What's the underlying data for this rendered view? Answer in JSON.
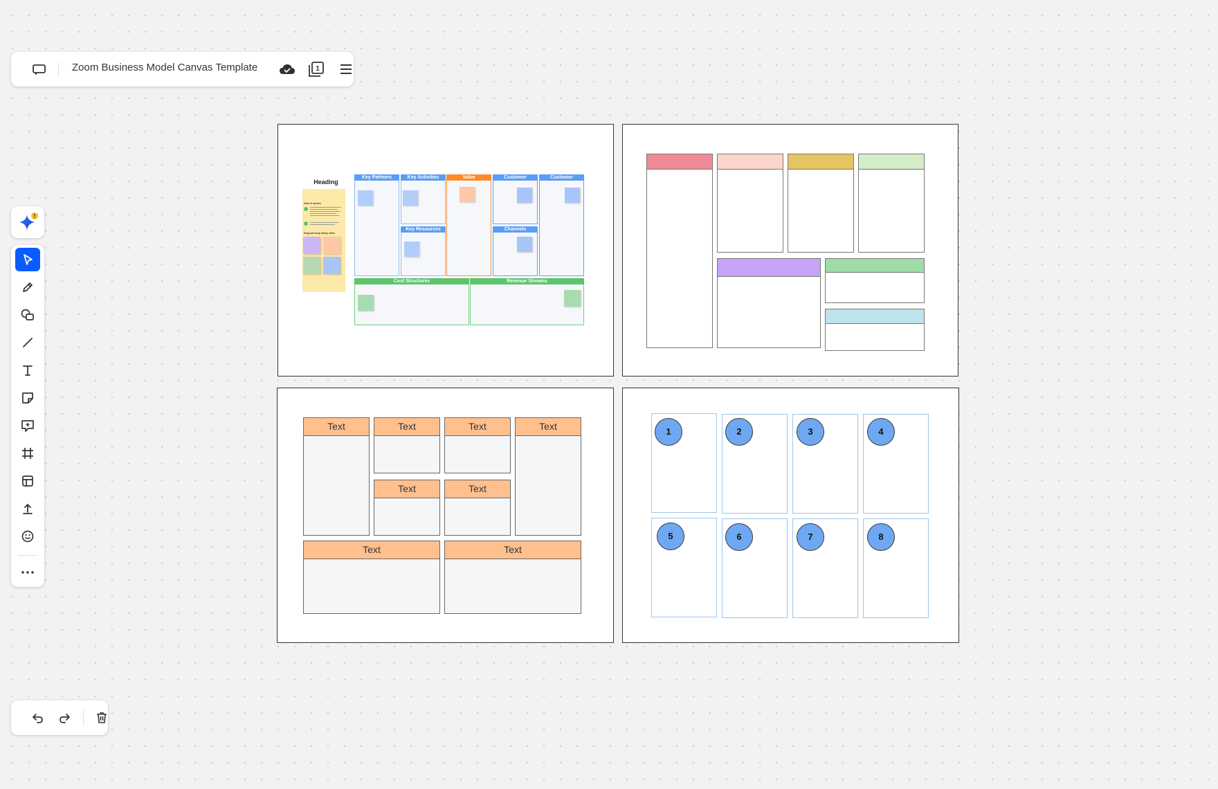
{
  "topbar": {
    "title": "Zoom Business Model Canvas Template",
    "icons": [
      "toggle-sidebar-icon",
      "cloud-saved-icon",
      "pages-icon",
      "menu-icon"
    ],
    "pages_count": "1"
  },
  "ai_assistant": {
    "icon": "ai-sparkle-icon",
    "badge": "!"
  },
  "tools": [
    {
      "name": "select",
      "icon": "pointer-icon",
      "active": true
    },
    {
      "name": "pen",
      "icon": "pen-icon"
    },
    {
      "name": "shapes",
      "icon": "shapes-icon"
    },
    {
      "name": "line",
      "icon": "line-icon"
    },
    {
      "name": "text",
      "icon": "text-icon"
    },
    {
      "name": "sticky-note",
      "icon": "sticky-note-icon"
    },
    {
      "name": "comment",
      "icon": "comment-icon"
    },
    {
      "name": "frame",
      "icon": "frame-icon"
    },
    {
      "name": "templates",
      "icon": "template-icon"
    },
    {
      "name": "upload",
      "icon": "upload-icon"
    },
    {
      "name": "reactions",
      "icon": "emoji-icon"
    },
    {
      "name": "more",
      "icon": "more-icon"
    }
  ],
  "history": {
    "icons": [
      "undo-icon",
      "redo-icon",
      "trash-icon"
    ]
  },
  "frame1": {
    "heading": "Heading",
    "sidebar_title": "How it works",
    "sidebar_drag": "Drag and drop sticky notes",
    "sections": {
      "key_partners": "Key Partners",
      "key_activities": "Key Activities",
      "key_resources": "Key Resources",
      "value": "Value",
      "customer_1": "Customer",
      "channels": "Channels",
      "customer_2": "Customer",
      "cost_structures": "Cost Structures",
      "revenue_streams": "Revenue Streams"
    },
    "colors": {
      "blue": "#5b9cf5",
      "orange": "#ff8a2a",
      "green": "#5cc46a",
      "yellow": "#fde9a8"
    }
  },
  "frame2": {
    "colors": [
      "#f08a96",
      "#fcd6cc",
      "#e5c462",
      "#d5ecc9",
      "#c7a4f7",
      "#9fdca8",
      "#bde3ec"
    ]
  },
  "frame3": {
    "cells": [
      "Text",
      "Text",
      "Text",
      "Text",
      "Text",
      "Text",
      "Text",
      "Text"
    ]
  },
  "frame4": {
    "numbers": [
      "1",
      "2",
      "3",
      "4",
      "5",
      "6",
      "7",
      "8"
    ]
  }
}
